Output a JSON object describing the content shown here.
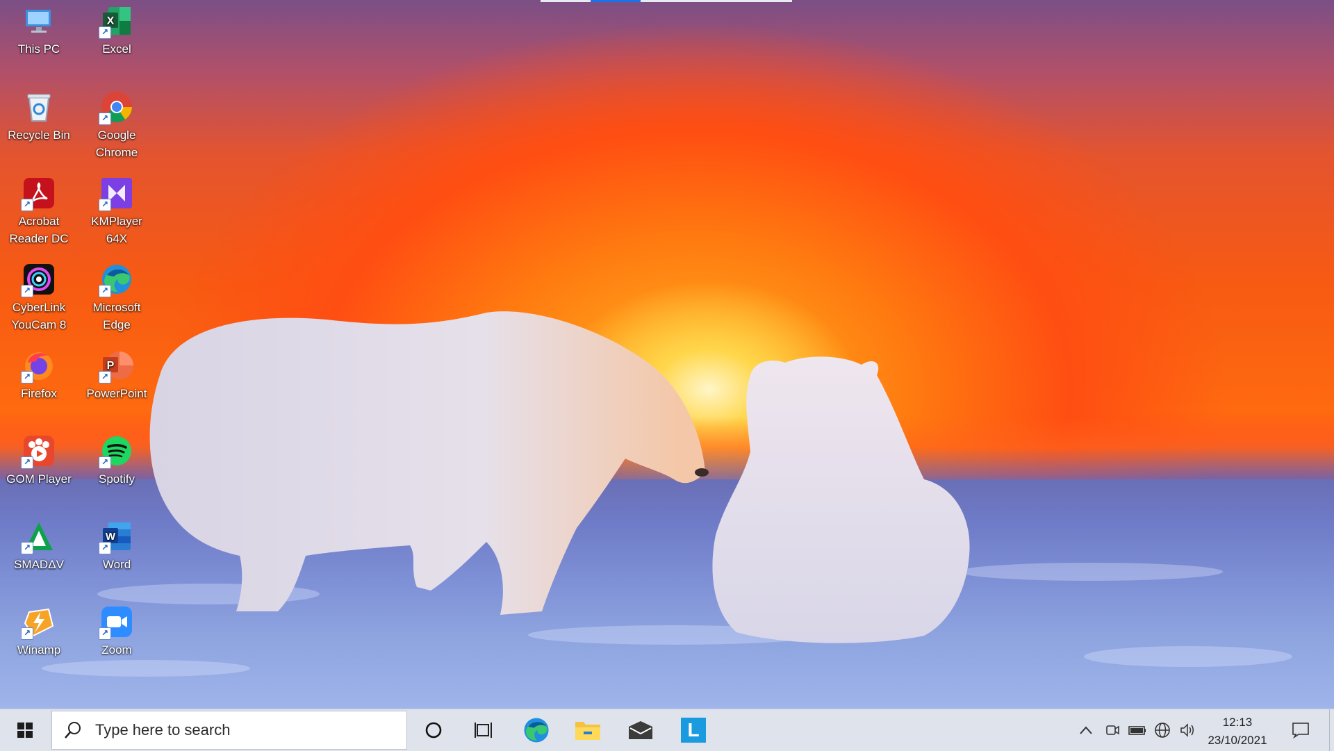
{
  "desktop": {
    "icons": [
      {
        "label_line1": "This PC",
        "label_line2": "",
        "icon": "this-pc-icon"
      },
      {
        "label_line1": "Excel",
        "label_line2": "",
        "icon": "excel-icon"
      },
      {
        "label_line1": "Recycle Bin",
        "label_line2": "",
        "icon": "recycle-bin-icon"
      },
      {
        "label_line1": "Google",
        "label_line2": "Chrome",
        "icon": "chrome-icon"
      },
      {
        "label_line1": "Acrobat",
        "label_line2": "Reader DC",
        "icon": "acrobat-icon"
      },
      {
        "label_line1": "KMPlayer",
        "label_line2": "64X",
        "icon": "kmplayer-icon"
      },
      {
        "label_line1": "CyberLink",
        "label_line2": "YouCam 8",
        "icon": "youcam-icon"
      },
      {
        "label_line1": "Microsoft",
        "label_line2": "Edge",
        "icon": "edge-icon"
      },
      {
        "label_line1": "Firefox",
        "label_line2": "",
        "icon": "firefox-icon"
      },
      {
        "label_line1": "PowerPoint",
        "label_line2": "",
        "icon": "powerpoint-icon"
      },
      {
        "label_line1": "GOM Player",
        "label_line2": "",
        "icon": "gom-player-icon"
      },
      {
        "label_line1": "Spotify",
        "label_line2": "",
        "icon": "spotify-icon"
      },
      {
        "label_line1": "SMADΔV",
        "label_line2": "",
        "icon": "smadav-icon"
      },
      {
        "label_line1": "Word",
        "label_line2": "",
        "icon": "word-icon"
      },
      {
        "label_line1": "Winamp",
        "label_line2": "",
        "icon": "winamp-icon"
      },
      {
        "label_line1": "Zoom",
        "label_line2": "",
        "icon": "zoom-icon"
      }
    ],
    "shortcut_arrow": "↗"
  },
  "taskbar": {
    "search_placeholder": "Type here to search",
    "pinned": [
      "cortana-icon",
      "task-view-icon",
      "edge-icon",
      "file-explorer-icon",
      "mail-icon",
      "l-app-icon"
    ],
    "l_app_letter": "L",
    "tray": {
      "time": "12:13",
      "date": "23/10/2021",
      "chevron": "^"
    }
  },
  "colors": {
    "taskbar_bg": "#dfe3ec",
    "accent_blue": "#1a73e8"
  }
}
